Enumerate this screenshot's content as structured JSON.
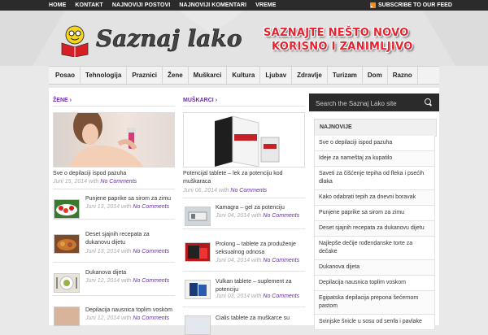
{
  "topnav": [
    "HOME",
    "KONTAKT",
    "NAJNOVIJI POSTOVI",
    "NAJNOVIJI KOMENTARI",
    "VREME"
  ],
  "subscribe": "SUBSCRIBE TO OUR FEED",
  "logo_text": "Saznaj lako",
  "tagline": [
    "SAZNAJTE NEŠTO NOVO",
    "KORISNO I ZANIMLJIVO"
  ],
  "mainnav": [
    "Posao",
    "Tehnologija",
    "Praznici",
    "Žene",
    "Muškarci",
    "Kultura",
    "Ljubav",
    "Zdravlje",
    "Turizam",
    "Dom",
    "Razno"
  ],
  "left": {
    "heading": "ŽENE",
    "featured": {
      "title": "Sve o depilaciji ispod pazuha",
      "date": "Juni 15, 2014",
      "by": "with",
      "comments": "No Comments"
    },
    "items": [
      {
        "title": "Punjene paprike sa sirom za zimu",
        "date": "Juni 13, 2014",
        "comments": "No Comments"
      },
      {
        "title": "Deset sjajnih recepata za dukanovu dijetu",
        "date": "Juni 13, 2014",
        "comments": "No Comments"
      },
      {
        "title": "Dukanova dijeta",
        "date": "Juni 12, 2014",
        "comments": "No Comments"
      },
      {
        "title": "Depilacija nausnica toplim voskom",
        "date": "Juni 12, 2014",
        "comments": "No Comments"
      }
    ]
  },
  "mid": {
    "heading": "MUŠKARCI",
    "featured": {
      "title": "Potencijal tablete – lek za potenciju kod muškaraca",
      "date": "Juni 06, 2014",
      "by": "with",
      "comments": "No Comments"
    },
    "items": [
      {
        "title": "Kamagra – gel za potenciju",
        "date": "Juni 04, 2014",
        "comments": "No Comments"
      },
      {
        "title": "Prolong – tablete za produženje seksualnog odnosa",
        "date": "Juni 04, 2014",
        "comments": "No Comments"
      },
      {
        "title": "Vulkan tablete – suplement za potenciju",
        "date": "Juni 03, 2014",
        "comments": "No Comments"
      },
      {
        "title": "Cialis tablete za muškarce su",
        "date": "",
        "comments": ""
      }
    ]
  },
  "search": {
    "placeholder": "Search the Saznaj Lako site"
  },
  "sidebar": {
    "heading": "NAJNOVIJE",
    "items": [
      "Sve o depilaciji ispod pazuha",
      "Ideje za nameštaj za kupatilo",
      "Saveti za čišćenje tepiha od fleka i psećih dlaka",
      "Kako odabrati tepih za dnevni boravak",
      "Punjene paprike sa sirom za zimu",
      "Deset sjajnih recepata za dukanovu dijetu",
      "Najlepše dečije rođendanske torte za dečake",
      "Dukanova dijeta",
      "Depilacija nausnica toplim voskom",
      "Egipatska depilacija prepona šećernom pastom",
      "Svinjske šnicle u sosu od senfa i pavlake"
    ]
  },
  "colors": {
    "accent": "#6a2dac",
    "topbar": "#2b2b2b",
    "tagline": "#e8232f"
  }
}
